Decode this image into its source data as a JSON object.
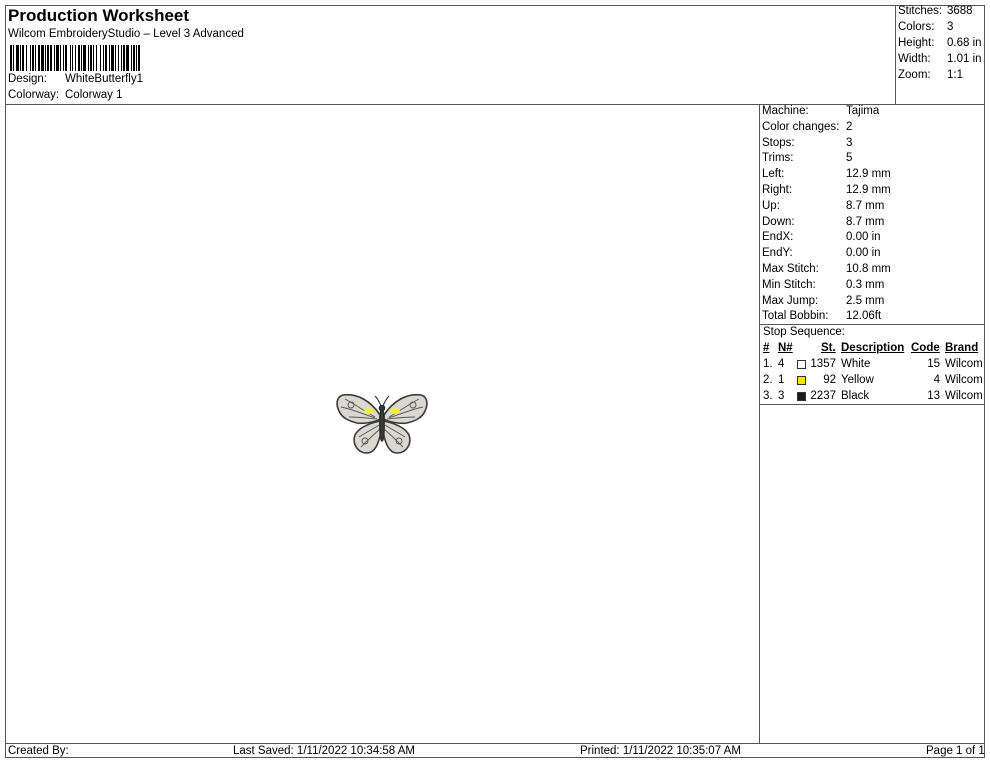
{
  "header": {
    "title": "Production Worksheet",
    "subtitle": "Wilcom EmbroideryStudio – Level 3 Advanced",
    "design_label": "Design:",
    "design_value": "WhiteButterfly1",
    "colorway_label": "Colorway:",
    "colorway_value": "Colorway 1"
  },
  "summary": {
    "stitches_label": "Stitches:",
    "stitches_value": "3688",
    "colors_label": "Colors:",
    "colors_value": "3",
    "height_label": "Height:",
    "height_value": "0.68 in",
    "width_label": "Width:",
    "width_value": "1.01 in",
    "zoom_label": "Zoom:",
    "zoom_value": "1:1"
  },
  "machine_info": [
    {
      "label": "Machine:",
      "value": "Tajima"
    },
    {
      "label": "Color changes:",
      "value": "2"
    },
    {
      "label": "Stops:",
      "value": "3"
    },
    {
      "label": "Trims:",
      "value": "5"
    },
    {
      "label": "Left:",
      "value": "12.9 mm"
    },
    {
      "label": "Right:",
      "value": "12.9 mm"
    },
    {
      "label": "Up:",
      "value": "8.7 mm"
    },
    {
      "label": "Down:",
      "value": "8.7 mm"
    },
    {
      "label": "EndX:",
      "value": "0.00 in"
    },
    {
      "label": "EndY:",
      "value": "0.00 in"
    },
    {
      "label": "Max Stitch:",
      "value": "10.8 mm"
    },
    {
      "label": "Min Stitch:",
      "value": "0.3 mm"
    },
    {
      "label": "Max Jump:",
      "value": "2.5 mm"
    },
    {
      "label": "Total Bobbin:",
      "value": "12.06ft"
    }
  ],
  "stop_sequence": {
    "title": "Stop Sequence:",
    "headers": {
      "num": "#",
      "needle": "N#",
      "stitches": "St.",
      "description": "Description",
      "code": "Code",
      "brand": "Brand"
    },
    "rows": [
      {
        "num": "1.",
        "needle": "4",
        "color": "#ffffff",
        "stitches": "1357",
        "description": "White",
        "code": "15",
        "brand": "Wilcom"
      },
      {
        "num": "2.",
        "needle": "1",
        "color": "#f5e400",
        "stitches": "92",
        "description": "Yellow",
        "code": "4",
        "brand": "Wilcom"
      },
      {
        "num": "3.",
        "needle": "3",
        "color": "#1a1a1a",
        "stitches": "2237",
        "description": "Black",
        "code": "13",
        "brand": "Wilcom"
      }
    ]
  },
  "footer": {
    "created_by": "Created By:",
    "last_saved": "Last Saved: 1/11/2022 10:34:58 AM",
    "printed": "Printed: 1/11/2022 10:35:07 AM",
    "page": "Page 1 of 1"
  },
  "design_preview": {
    "icon": "butterfly-embroidery-icon"
  }
}
